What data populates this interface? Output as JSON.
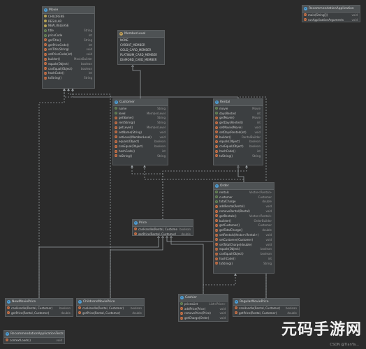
{
  "diagram": {
    "classes": [
      {
        "id": "movie",
        "title": "Movie",
        "kind": "c",
        "enum_constants": [
          "CHILDRENS",
          "REGULAR",
          "NEW_RELEASE"
        ],
        "members": [
          {
            "icon": "f",
            "name": "title",
            "type": "String"
          },
          {
            "icon": "f",
            "name": "priceCode",
            "type": "int"
          },
          {
            "icon": "m",
            "name": "getTitle()",
            "type": "String"
          },
          {
            "icon": "m",
            "name": "getPriceCode()",
            "type": "int"
          },
          {
            "icon": "m",
            "name": "setTitle(String)",
            "type": "void"
          },
          {
            "icon": "m",
            "name": "setPriceCode(int)",
            "type": "void"
          },
          {
            "icon": "m",
            "name": "builder()",
            "type": "MovieBuilder"
          },
          {
            "icon": "m",
            "name": "equals(Object)",
            "type": "boolean"
          },
          {
            "icon": "m",
            "name": "canEqual(Object)",
            "type": "boolean"
          },
          {
            "icon": "m",
            "name": "hashCode()",
            "type": "int"
          },
          {
            "icon": "m",
            "name": "toString()",
            "type": "String"
          }
        ]
      },
      {
        "id": "membership",
        "title": "MemberLevel",
        "kind": "e",
        "enum_constants": [
          "NONE",
          "CARDAT_MEMBER",
          "GOLD_CARD_MEMBER",
          "PLATINUM_CARD_MEMBER",
          "DIAMOND_CARD_MEMBER"
        ],
        "members": []
      },
      {
        "id": "app",
        "title": "RecommendationApplication",
        "kind": "c",
        "enum_constants": [],
        "members": [
          {
            "icon": "m",
            "name": "main(String[])",
            "type": "void"
          },
          {
            "icon": "m",
            "name": "runApplicationArguments",
            "type": "void"
          }
        ]
      },
      {
        "id": "customer",
        "title": "Customer",
        "kind": "c",
        "enum_constants": [],
        "members": [
          {
            "icon": "f",
            "name": "name",
            "type": "String"
          },
          {
            "icon": "f",
            "name": "level",
            "type": "MemberLevel"
          },
          {
            "icon": "m",
            "name": "getName()",
            "type": "String"
          },
          {
            "icon": "m",
            "name": "rentString()",
            "type": "String"
          },
          {
            "icon": "m",
            "name": "getLevel()",
            "type": "MemberLevel"
          },
          {
            "icon": "m",
            "name": "setName(String)",
            "type": "void"
          },
          {
            "icon": "m",
            "name": "setLevel(MemberLevel)",
            "type": "void"
          },
          {
            "icon": "m",
            "name": "equals(Object)",
            "type": "boolean"
          },
          {
            "icon": "m",
            "name": "canEqual(Object)",
            "type": "boolean"
          },
          {
            "icon": "m",
            "name": "hashCode()",
            "type": "int"
          },
          {
            "icon": "m",
            "name": "toString()",
            "type": "String"
          }
        ]
      },
      {
        "id": "rental",
        "title": "Rental",
        "kind": "c",
        "enum_constants": [],
        "members": [
          {
            "icon": "f",
            "name": "movie",
            "type": "Movie"
          },
          {
            "icon": "f",
            "name": "daysRented",
            "type": "int"
          },
          {
            "icon": "m",
            "name": "getMovie()",
            "type": "Movie"
          },
          {
            "icon": "m",
            "name": "getDaysRented()",
            "type": "int"
          },
          {
            "icon": "m",
            "name": "setMovie(Movie)",
            "type": "void"
          },
          {
            "icon": "m",
            "name": "setDaysRented(int)",
            "type": "void"
          },
          {
            "icon": "m",
            "name": "builder()",
            "type": "RentalBuilder"
          },
          {
            "icon": "m",
            "name": "equals(Object)",
            "type": "boolean"
          },
          {
            "icon": "m",
            "name": "canEqual(Object)",
            "type": "boolean"
          },
          {
            "icon": "m",
            "name": "hashCode()",
            "type": "int"
          },
          {
            "icon": "m",
            "name": "toString()",
            "type": "String"
          }
        ]
      },
      {
        "id": "order",
        "title": "Order",
        "kind": "c",
        "enum_constants": [],
        "members": [
          {
            "icon": "f",
            "name": "rentals",
            "type": "Vector<Rental>"
          },
          {
            "icon": "f",
            "name": "customer",
            "type": "Customer"
          },
          {
            "icon": "f",
            "name": "totalCharge",
            "type": "double"
          },
          {
            "icon": "m",
            "name": "addRental(Rental)",
            "type": "void"
          },
          {
            "icon": "m",
            "name": "removeRental(Rental)",
            "type": "void"
          },
          {
            "icon": "m",
            "name": "getRentals()",
            "type": "Vector<Rental>"
          },
          {
            "icon": "m",
            "name": "builder()",
            "type": "OrderBuilder"
          },
          {
            "icon": "m",
            "name": "getCustomer()",
            "type": "Customer"
          },
          {
            "icon": "m",
            "name": "getTotalCharge()",
            "type": "double"
          },
          {
            "icon": "m",
            "name": "setRentals(Vector<Rental>)",
            "type": "void"
          },
          {
            "icon": "m",
            "name": "setCustomer(Customer)",
            "type": "void"
          },
          {
            "icon": "m",
            "name": "setTotalCharge(double)",
            "type": "void"
          },
          {
            "icon": "m",
            "name": "equals(Object)",
            "type": "boolean"
          },
          {
            "icon": "m",
            "name": "canEqual(Object)",
            "type": "boolean"
          },
          {
            "icon": "m",
            "name": "hashCode()",
            "type": "int"
          },
          {
            "icon": "m",
            "name": "toString()",
            "type": "String"
          }
        ]
      },
      {
        "id": "price",
        "title": "Price",
        "kind": "c",
        "enum_constants": [],
        "members": [
          {
            "icon": "m",
            "name": "canHandle(Rental, Customer)",
            "type": "boolean"
          },
          {
            "icon": "m",
            "name": "getPrice(Rental, Customer)",
            "type": "double"
          }
        ]
      },
      {
        "id": "newmovieprice",
        "title": "NewMoviePrice",
        "kind": "c",
        "enum_constants": [],
        "members": [
          {
            "icon": "m",
            "name": "canHandle(Rental, Customer)",
            "type": "boolean"
          },
          {
            "icon": "m",
            "name": "getPrice(Rental, Customer)",
            "type": "double"
          }
        ]
      },
      {
        "id": "childrensmovieprice",
        "title": "ChildrensMoviePrice",
        "kind": "c",
        "enum_constants": [],
        "members": [
          {
            "icon": "m",
            "name": "canHandle(Rental, Customer)",
            "type": "boolean"
          },
          {
            "icon": "m",
            "name": "getPrice(Rental, Customer)",
            "type": "double"
          }
        ]
      },
      {
        "id": "cashier",
        "title": "Cashier",
        "kind": "c",
        "enum_constants": [],
        "members": [
          {
            "icon": "f",
            "name": "pricesList",
            "type": "List<Price>"
          },
          {
            "icon": "m",
            "name": "addPrice(Price)",
            "type": "void"
          },
          {
            "icon": "m",
            "name": "removePrice(Price)",
            "type": "void"
          },
          {
            "icon": "m",
            "name": "getCharge(Order)",
            "type": "void"
          }
        ]
      },
      {
        "id": "regularmovieprice",
        "title": "RegularMoviePrice",
        "kind": "c",
        "enum_constants": [],
        "members": [
          {
            "icon": "m",
            "name": "canHandle(Rental, Customer)",
            "type": "boolean"
          },
          {
            "icon": "m",
            "name": "getPrice(Rental, Customer)",
            "type": "double"
          }
        ]
      },
      {
        "id": "apptests",
        "title": "RecommendationApplicationTests",
        "kind": "c",
        "enum_constants": [],
        "members": [
          {
            "icon": "m",
            "name": "contextLoads()",
            "type": "void"
          }
        ]
      }
    ],
    "edges": [
      {
        "from": "customer",
        "to": "membership",
        "style": "solid"
      },
      {
        "from": "rental",
        "to": "movie",
        "style": "dashed"
      },
      {
        "from": "order",
        "to": "rental",
        "style": "solid"
      },
      {
        "from": "order",
        "to": "customer",
        "style": "dashed"
      },
      {
        "from": "price",
        "to": "rental",
        "style": "dashed"
      },
      {
        "from": "price",
        "to": "customer",
        "style": "dashed"
      },
      {
        "from": "newmovieprice",
        "to": "price",
        "style": "solid"
      },
      {
        "from": "childrensmovieprice",
        "to": "price",
        "style": "solid"
      },
      {
        "from": "regularmovieprice",
        "to": "price",
        "style": "solid"
      },
      {
        "from": "cashier",
        "to": "price",
        "style": "solid"
      },
      {
        "from": "cashier",
        "to": "order",
        "style": "dashed"
      },
      {
        "from": "newmovieprice",
        "to": "movie",
        "style": "dashed"
      },
      {
        "from": "childrensmovieprice",
        "to": "movie",
        "style": "dashed"
      },
      {
        "from": "regularmovieprice",
        "to": "movie",
        "style": "dashed"
      }
    ],
    "colors": {
      "background": "#2b2b2b",
      "class_fill": "#3c3f41",
      "edge_solid": "#9aa0a4",
      "edge_dashed": "#9aa0a4"
    }
  },
  "watermark": {
    "text": "元码手游网",
    "sub": "CSDN @TianYa..."
  }
}
